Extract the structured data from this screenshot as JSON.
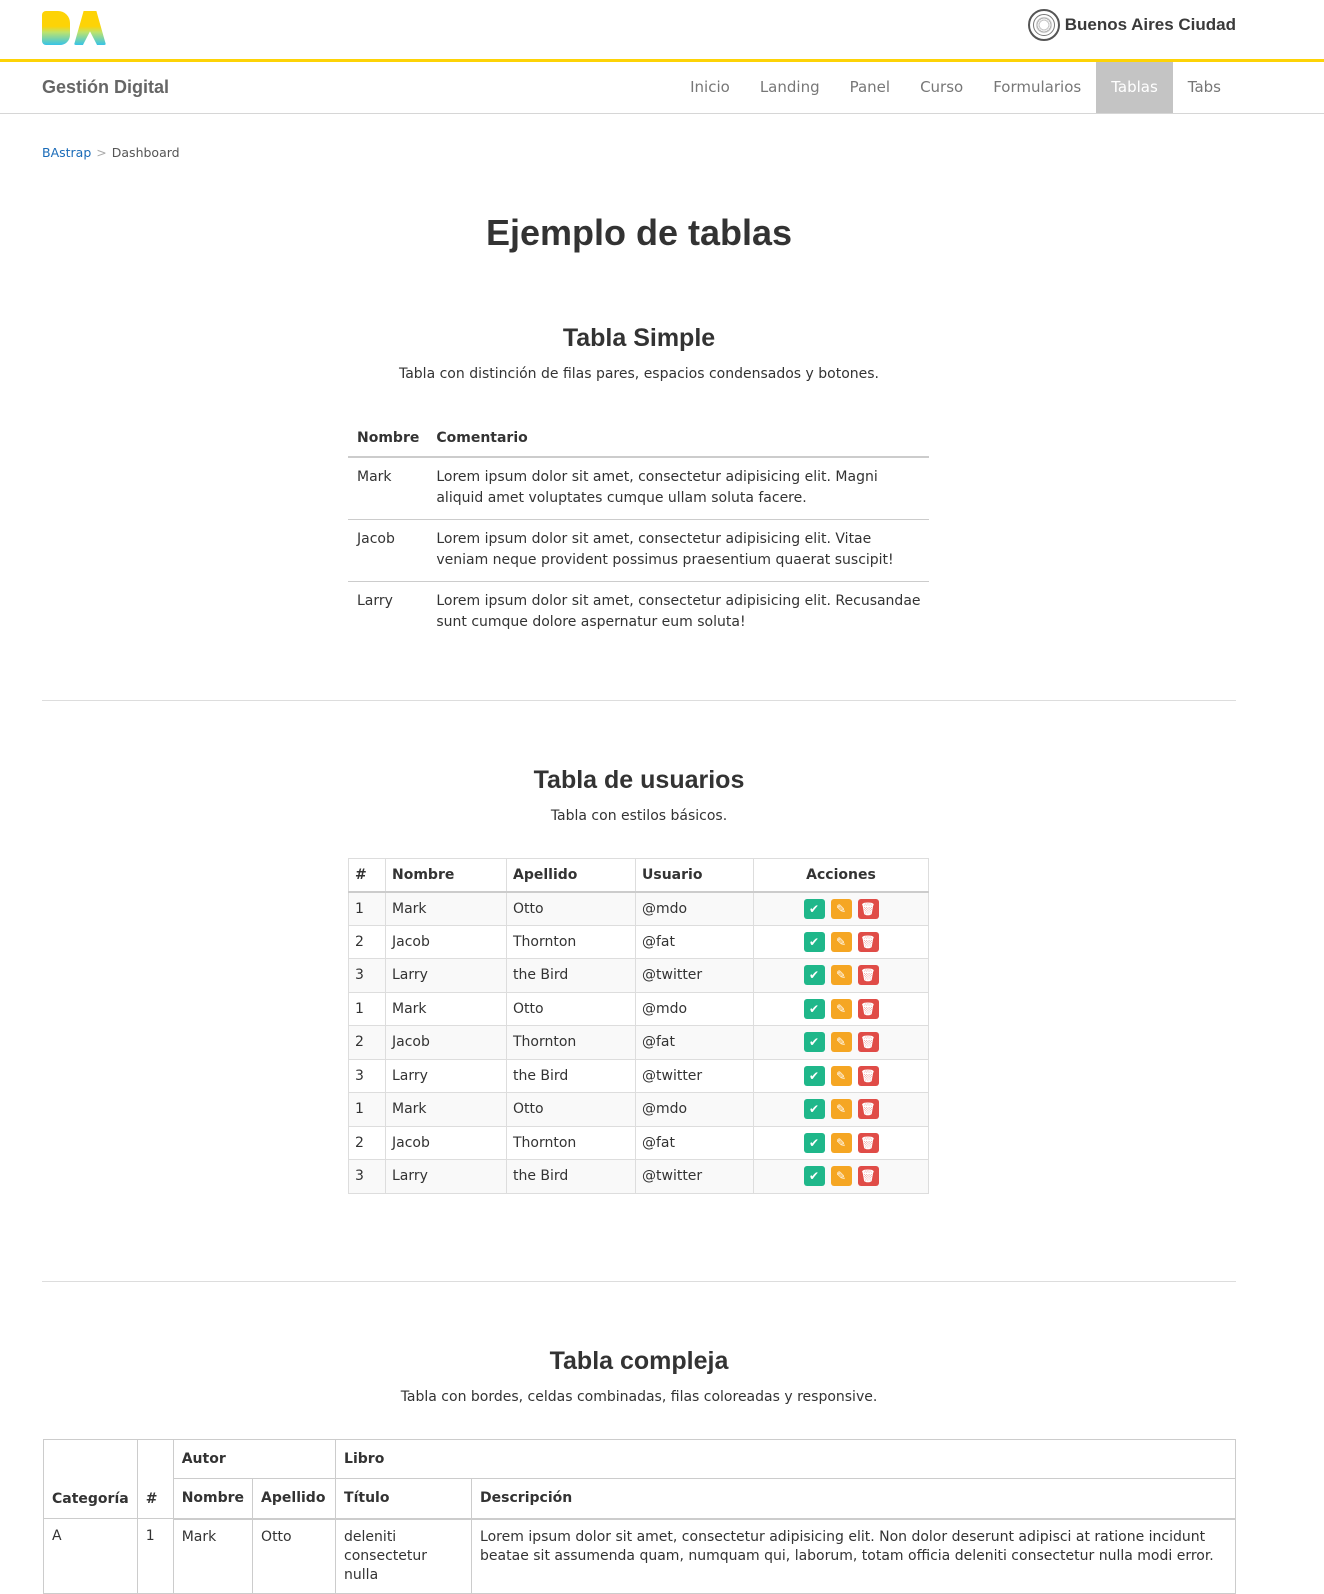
{
  "header": {
    "logo_text": "BA",
    "city_name": "Buenos Aires Ciudad",
    "accent": "#fdd306"
  },
  "navbar": {
    "brand": "Gestión Digital",
    "items": [
      "Inicio",
      "Landing",
      "Panel",
      "Curso",
      "Formularios",
      "Tablas",
      "Tabs"
    ],
    "active": "Tablas"
  },
  "breadcrumb": {
    "root": "BAstrap",
    "separator": ">",
    "current": "Dashboard"
  },
  "page_title": "Ejemplo de tablas",
  "simple": {
    "title": "Tabla Simple",
    "subtitle": "Tabla con distinción de filas pares, espacios condensados y botones.",
    "headers": [
      "Nombre",
      "Comentario"
    ],
    "rows": [
      [
        "Mark",
        "Lorem ipsum dolor sit amet, consectetur adipisicing elit. Magni aliquid amet voluptates cumque ullam soluta facere."
      ],
      [
        "Jacob",
        "Lorem ipsum dolor sit amet, consectetur adipisicing elit. Vitae veniam neque provident possimus praesentium quaerat suscipit!"
      ],
      [
        "Larry",
        "Lorem ipsum dolor sit amet, consectetur adipisicing elit. Recusandae sunt cumque dolore aspernatur eum soluta!"
      ]
    ]
  },
  "users": {
    "title": "Tabla de usuarios",
    "subtitle": "Tabla con estilos básicos.",
    "headers": [
      "#",
      "Nombre",
      "Apellido",
      "Usuario",
      "Acciones"
    ],
    "rows": [
      [
        "1",
        "Mark",
        "Otto",
        "@mdo"
      ],
      [
        "2",
        "Jacob",
        "Thornton",
        "@fat"
      ],
      [
        "3",
        "Larry",
        "the Bird",
        "@twitter"
      ],
      [
        "1",
        "Mark",
        "Otto",
        "@mdo"
      ],
      [
        "2",
        "Jacob",
        "Thornton",
        "@fat"
      ],
      [
        "3",
        "Larry",
        "the Bird",
        "@twitter"
      ],
      [
        "1",
        "Mark",
        "Otto",
        "@mdo"
      ],
      [
        "2",
        "Jacob",
        "Thornton",
        "@fat"
      ],
      [
        "3",
        "Larry",
        "the Bird",
        "@twitter"
      ]
    ],
    "action_icons": [
      "check-icon",
      "pencil-icon",
      "trash-icon"
    ],
    "action_colors": [
      "#1fb78a",
      "#f5a623",
      "#e04c47"
    ]
  },
  "complex": {
    "title": "Tabla compleja",
    "subtitle": "Tabla con bordes, celdas combinadas, filas coloreadas y responsive.",
    "group_headers": {
      "autor": "Autor",
      "libro": "Libro"
    },
    "headers": [
      "Categoría",
      "#",
      "Nombre",
      "Apellido",
      "Título",
      "Descripción"
    ],
    "rows": [
      [
        "A",
        "1",
        "Mark",
        "Otto",
        "deleniti consectetur nulla",
        "Lorem ipsum dolor sit amet, consectetur adipisicing elit. Non dolor deserunt adipisci at ratione incidunt beatae sit assumenda quam, numquam qui, laborum, totam officia deleniti consectetur nulla modi error."
      ]
    ]
  }
}
